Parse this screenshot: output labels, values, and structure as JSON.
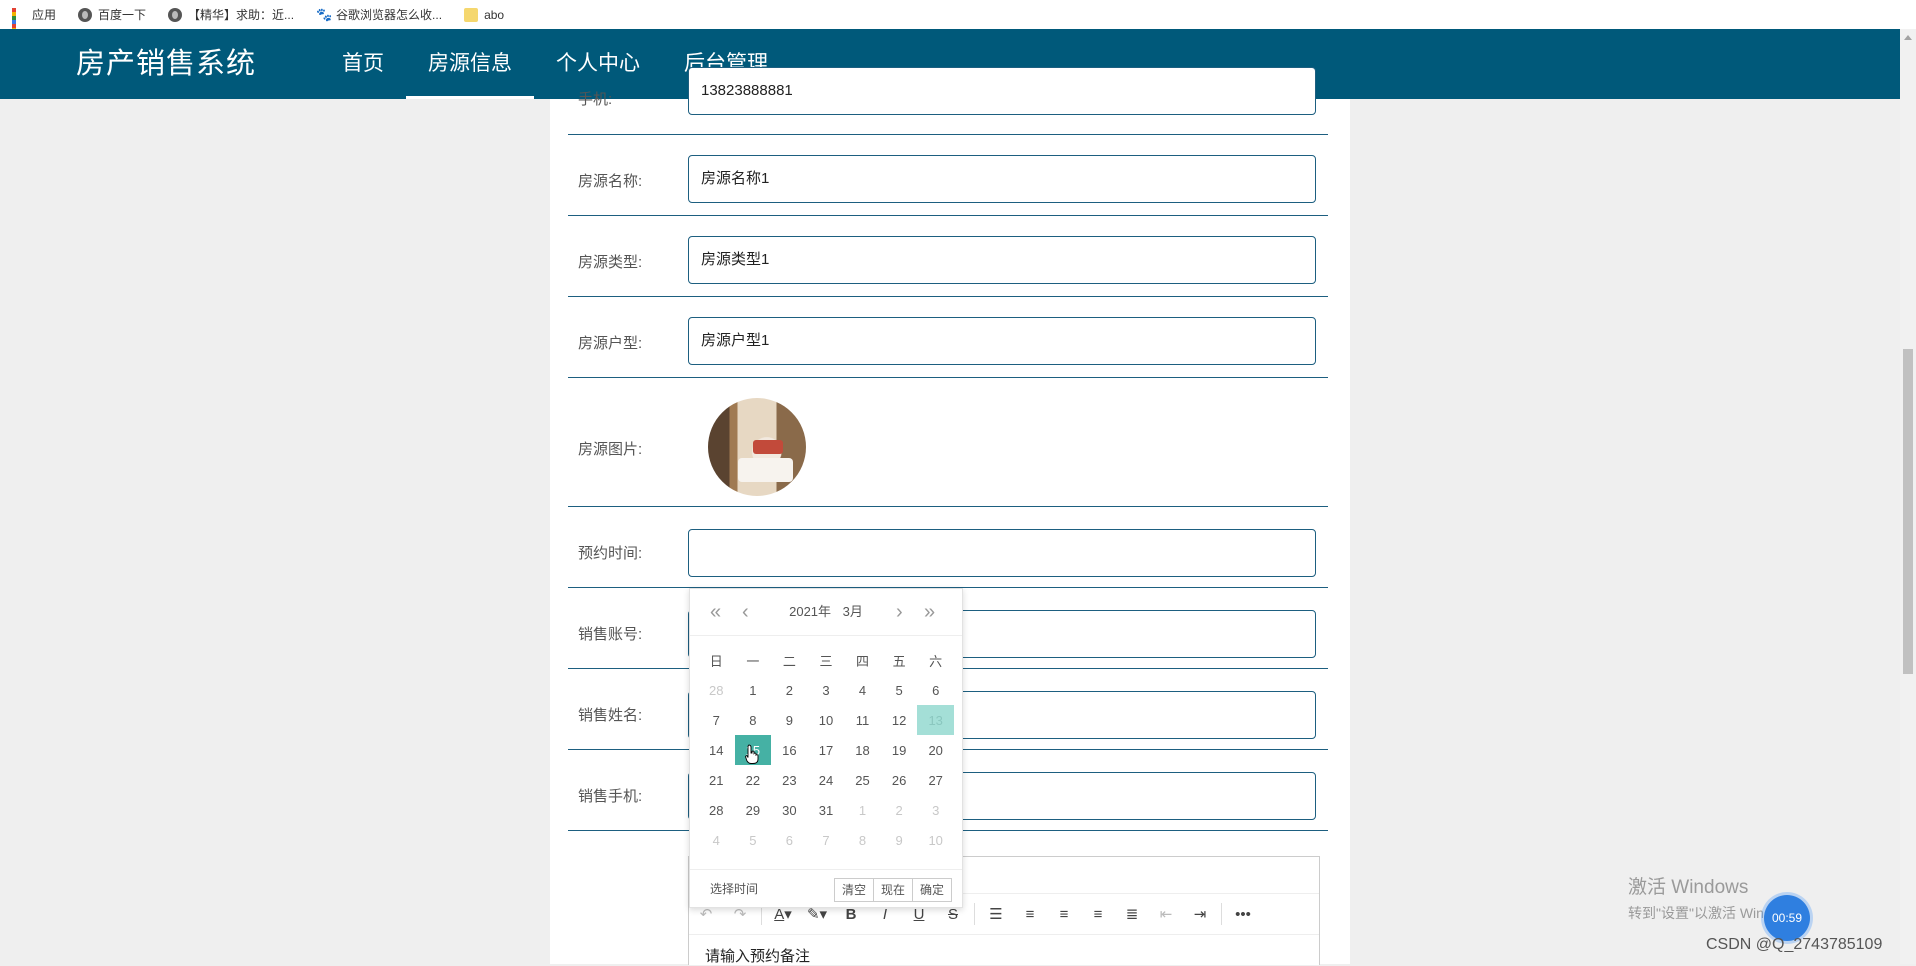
{
  "bookmarks": [
    {
      "label": "应用",
      "icon": "apps-icon"
    },
    {
      "label": "百度一下",
      "icon": "globe-icon"
    },
    {
      "label": "【精华】求助：近...",
      "icon": "globe-icon"
    },
    {
      "label": "谷歌浏览器怎么收...",
      "icon": "paw-icon"
    },
    {
      "label": "abo",
      "icon": "folder-icon"
    }
  ],
  "header": {
    "logo": "房产销售系统",
    "nav": [
      "首页",
      "房源信息",
      "个人中心",
      "后台管理"
    ],
    "active_nav": "房源信息",
    "color": "#00597a"
  },
  "form": {
    "phone": {
      "label": "手机:",
      "value": "13823888881"
    },
    "name": {
      "label": "房源名称:",
      "value": "房源名称1"
    },
    "type": {
      "label": "房源类型:",
      "value": "房源类型1"
    },
    "layout": {
      "label": "房源户型:",
      "value": "房源户型1"
    },
    "image": {
      "label": "房源图片:"
    },
    "appointment": {
      "label": "预约时间:",
      "value": ""
    },
    "sales_account": {
      "label": "销售账号:"
    },
    "sales_name": {
      "label": "销售姓名:"
    },
    "sales_phone": {
      "label": "销售手机:"
    }
  },
  "datepicker": {
    "year": "2021年",
    "month": "3月",
    "weekdays": [
      "日",
      "一",
      "二",
      "三",
      "四",
      "五",
      "六"
    ],
    "weeks": [
      [
        "28",
        "1",
        "2",
        "3",
        "4",
        "5",
        "6"
      ],
      [
        "7",
        "8",
        "9",
        "10",
        "11",
        "12",
        "13"
      ],
      [
        "14",
        "15",
        "16",
        "17",
        "18",
        "19",
        "20"
      ],
      [
        "21",
        "22",
        "23",
        "24",
        "25",
        "26",
        "27"
      ],
      [
        "28",
        "29",
        "30",
        "31",
        "1",
        "2",
        "3"
      ],
      [
        "4",
        "5",
        "6",
        "7",
        "8",
        "9",
        "10"
      ]
    ],
    "today": "13",
    "selected": "15",
    "select_time": "选择时间",
    "buttons": {
      "clear": "清空",
      "now": "现在",
      "confirm": "确定"
    },
    "accent_color": "#45b1a4"
  },
  "editor": {
    "placeholder": "请输入预约备注",
    "toolbar": [
      "undo-icon",
      "redo-icon",
      "font-color-icon",
      "highlight-icon",
      "bold-icon",
      "italic-icon",
      "underline-icon",
      "strikethrough-icon",
      "list-icon",
      "align-left-icon",
      "align-center-icon",
      "align-right-icon",
      "justify-icon",
      "outdent-icon",
      "indent-icon",
      "more-icon"
    ]
  },
  "watermark": {
    "line1": "激活 Windows",
    "line2": "转到\"设置\"以激活 Windows。",
    "timer": "00:59",
    "csdn": "CSDN @Q_2743785109"
  }
}
